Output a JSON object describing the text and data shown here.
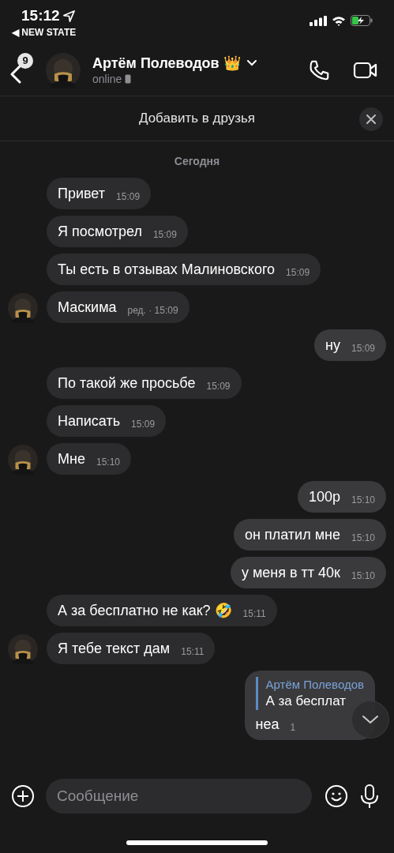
{
  "status_bar": {
    "time": "15:12",
    "back_app": "◀ NEW STATE"
  },
  "header": {
    "badge": "9",
    "name": "Артём Полеводов 👑",
    "status": "online"
  },
  "add_friend": {
    "label": "Добавить в друзья"
  },
  "date": "Сегодня",
  "messages": [
    {
      "kind": "in",
      "avatar": false,
      "text": "Привет",
      "time": "15:09"
    },
    {
      "kind": "in",
      "avatar": false,
      "text": "Я посмотрел",
      "time": "15:09"
    },
    {
      "kind": "in",
      "avatar": false,
      "text": "Ты есть в отзывах Малиновского",
      "time": "15:09"
    },
    {
      "kind": "in",
      "avatar": true,
      "text": "Маскима",
      "time": "ред. · 15:09"
    },
    {
      "kind": "out",
      "text": "ну",
      "time": "15:09"
    },
    {
      "kind": "in",
      "avatar": false,
      "text": "По такой же просьбе",
      "time": "15:09"
    },
    {
      "kind": "in",
      "avatar": false,
      "text": "Написать",
      "time": "15:09"
    },
    {
      "kind": "in",
      "avatar": true,
      "text": "Мне",
      "time": "15:10"
    },
    {
      "kind": "out",
      "text": "100р",
      "time": "15:10"
    },
    {
      "kind": "out",
      "text": "он платил мне",
      "time": "15:10"
    },
    {
      "kind": "out",
      "text": "у меня в тт 40к",
      "time": "15:10"
    },
    {
      "kind": "in",
      "avatar": false,
      "text": "А за бесплатно не как? 🤣",
      "time": "15:11"
    },
    {
      "kind": "in",
      "avatar": true,
      "text": "Я тебе текст дам",
      "time": "15:11"
    },
    {
      "kind": "out",
      "text": "неа",
      "time": "1",
      "reply": {
        "author": "Артём Полеводов",
        "text": "А за бесплат"
      }
    }
  ],
  "composer": {
    "placeholder": "Сообщение"
  }
}
